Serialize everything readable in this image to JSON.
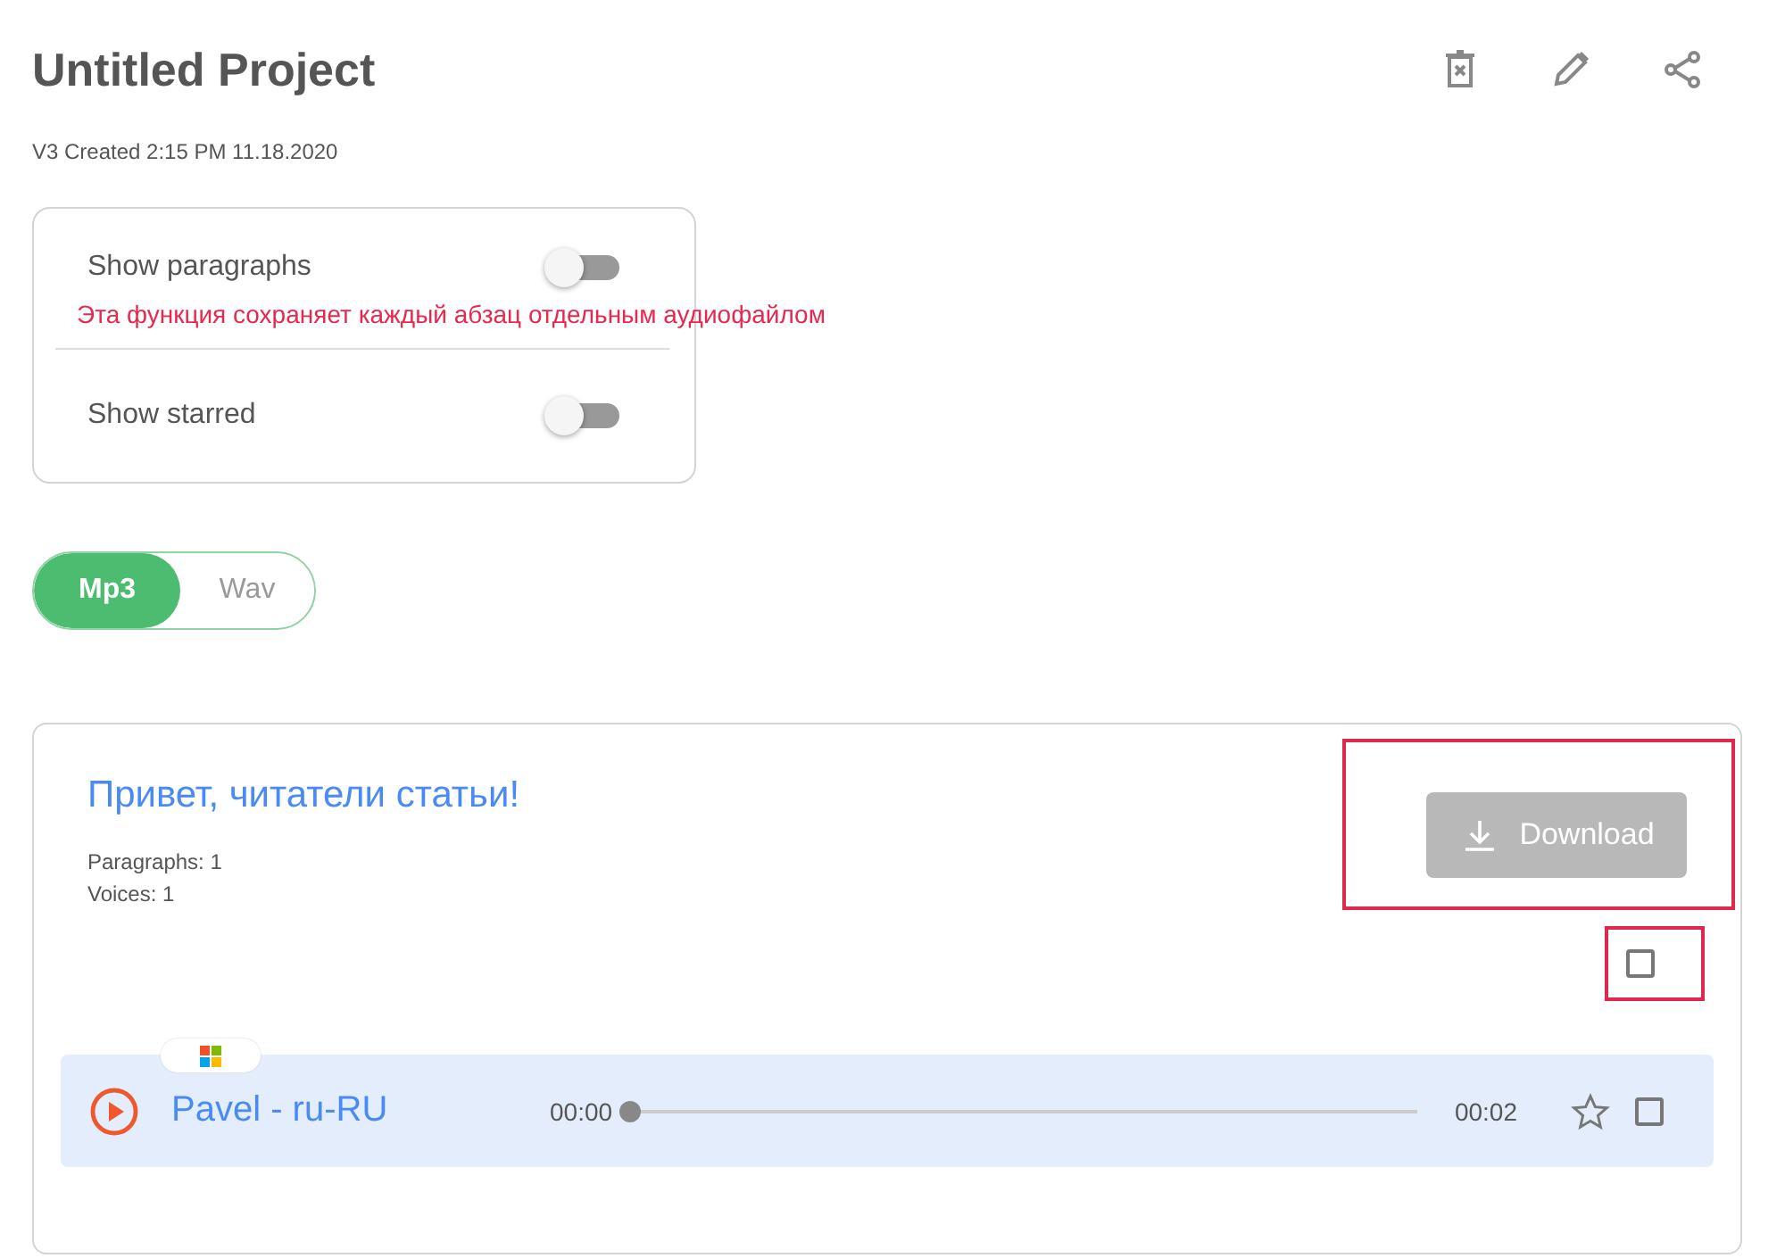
{
  "header": {
    "title": "Untitled Project",
    "subtitle": "V3 Created 2:15 PM 11.18.2020"
  },
  "settings": [
    {
      "label": "Show paragraphs",
      "on": false,
      "note": "Эта функция сохраняет каждый абзац отдельным аудиофайлом"
    },
    {
      "label": "Show starred",
      "on": false
    }
  ],
  "formats": [
    {
      "label": "Mp3",
      "selected": true
    },
    {
      "label": "Wav",
      "selected": false
    }
  ],
  "project": {
    "heading": "Привет, читатели статьи!",
    "stats": [
      "Paragraphs: 1",
      "Voices: 1"
    ],
    "download": {
      "label": "Download",
      "disabled": true,
      "highlighted": true
    },
    "select_all": {
      "checked": false,
      "highlighted": true
    },
    "voices": [
      {
        "name": "Pavel - ru-RU",
        "start": "00:00",
        "end": "00:02",
        "level": 0,
        "starred": false,
        "checked": false
      }
    ]
  }
}
